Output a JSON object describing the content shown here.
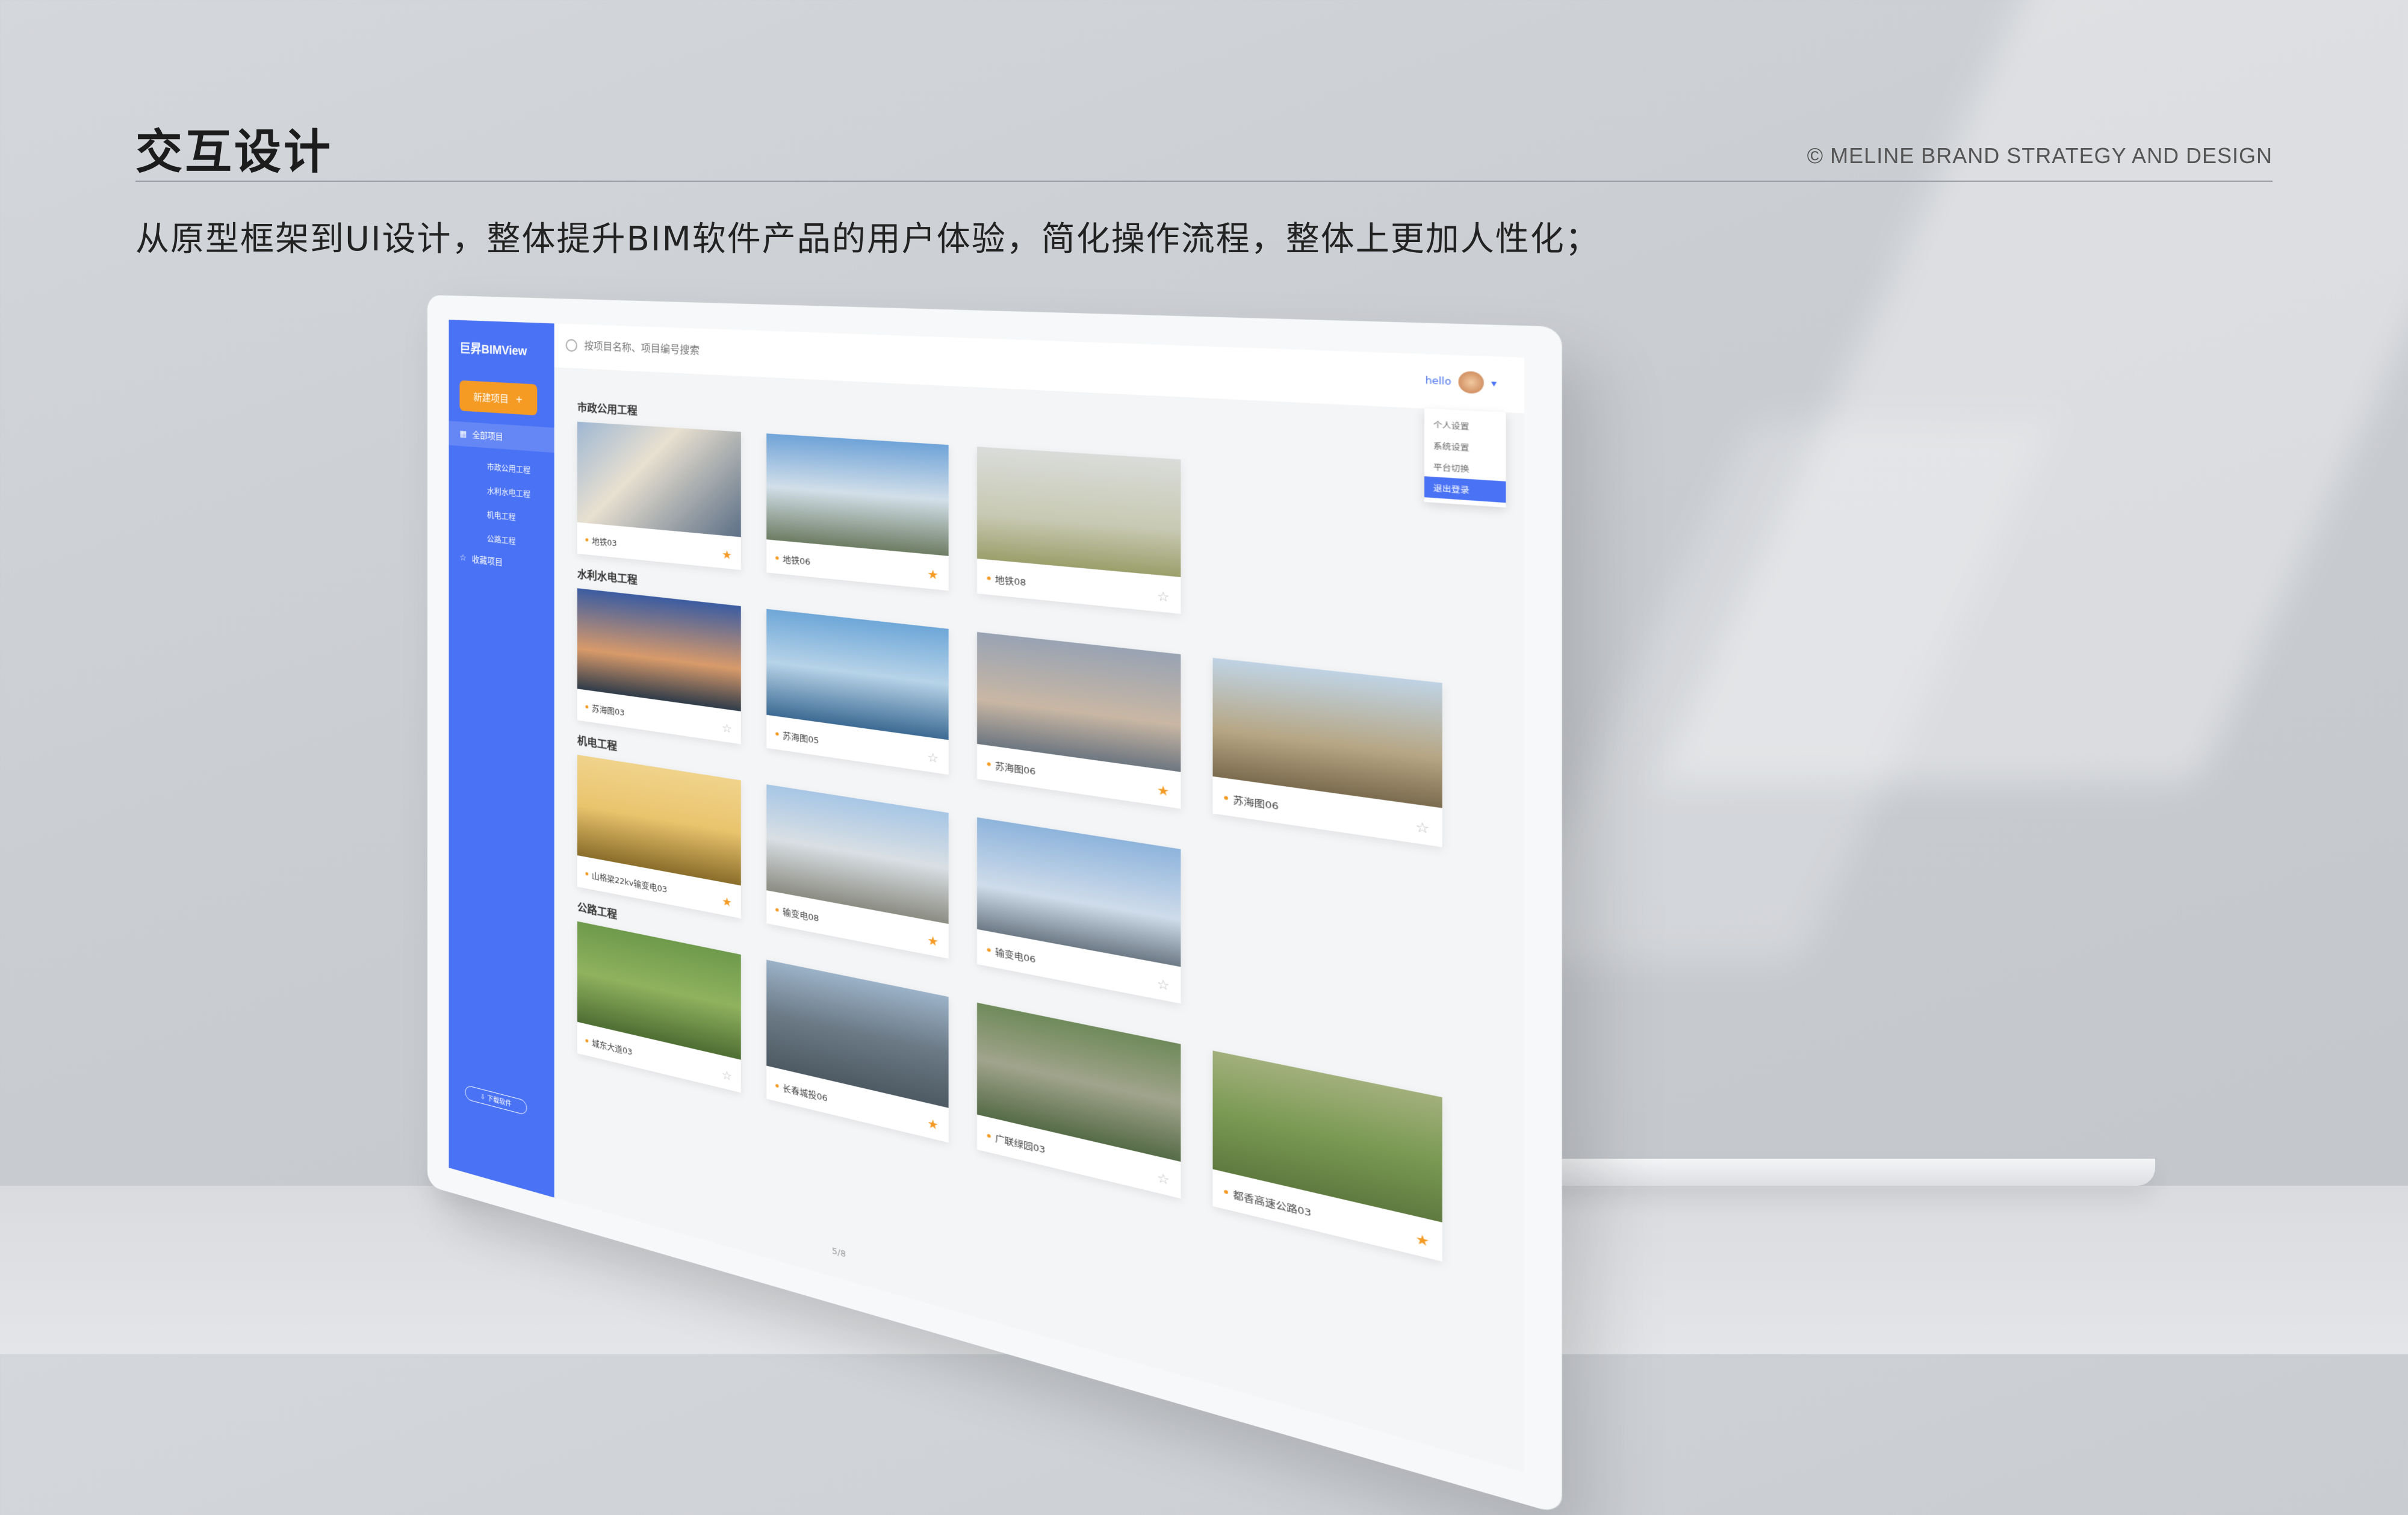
{
  "slide": {
    "title": "交互设计",
    "copyright": "© MELINE BRAND STRATEGY AND DESIGN",
    "subtitle": "从原型框架到UI设计，整体提升BIM软件产品的用户体验，简化操作流程，整体上更加人性化；"
  },
  "app": {
    "logo": "巨昇BIMView",
    "logo_sub": "",
    "new_project": "新建项目",
    "search_placeholder": "按项目名称、项目编号搜索",
    "user": "hello",
    "user_menu": [
      "个人设置",
      "系统设置",
      "平台切换",
      "退出登录"
    ],
    "nav": {
      "all": "全部项目",
      "sub": [
        "市政公用工程",
        "水利水电工程",
        "机电工程",
        "公路工程"
      ],
      "fav": "收藏项目"
    },
    "download": "下载软件",
    "footer": "",
    "pager": "5/8",
    "sections": [
      {
        "title": "市政公用工程",
        "cards": [
          {
            "name": "地铁03",
            "starred": true,
            "img": "i1"
          },
          {
            "name": "地铁06",
            "starred": true,
            "img": "i2"
          },
          {
            "name": "地铁08",
            "starred": false,
            "img": "i3"
          }
        ]
      },
      {
        "title": "水利水电工程",
        "cards": [
          {
            "name": "苏海图03",
            "starred": false,
            "img": "i4"
          },
          {
            "name": "苏海图05",
            "starred": false,
            "img": "i5"
          },
          {
            "name": "苏海图06",
            "starred": true,
            "img": "i6"
          },
          {
            "name": "苏海图06",
            "starred": false,
            "img": "i7"
          }
        ]
      },
      {
        "title": "机电工程",
        "cards": [
          {
            "name": "山格梁22kv输变电03",
            "starred": true,
            "img": "i8"
          },
          {
            "name": "输变电08",
            "starred": true,
            "img": "i9"
          },
          {
            "name": "输变电06",
            "starred": false,
            "img": "i10"
          }
        ]
      },
      {
        "title": "公路工程",
        "cards": [
          {
            "name": "城东大道03",
            "starred": false,
            "img": "i11"
          },
          {
            "name": "长春城投06",
            "starred": true,
            "img": "i12"
          },
          {
            "name": "广联绿园03",
            "starred": false,
            "img": "i13"
          },
          {
            "name": "都香高速公路03",
            "starred": true,
            "img": "i14"
          }
        ]
      }
    ]
  },
  "colors": {
    "sidebar": "#4a72f5",
    "accent": "#f59a23"
  },
  "icons": [
    "search-icon",
    "plus-icon",
    "grid-icon",
    "star-icon",
    "download-icon",
    "chevron-down-icon"
  ]
}
